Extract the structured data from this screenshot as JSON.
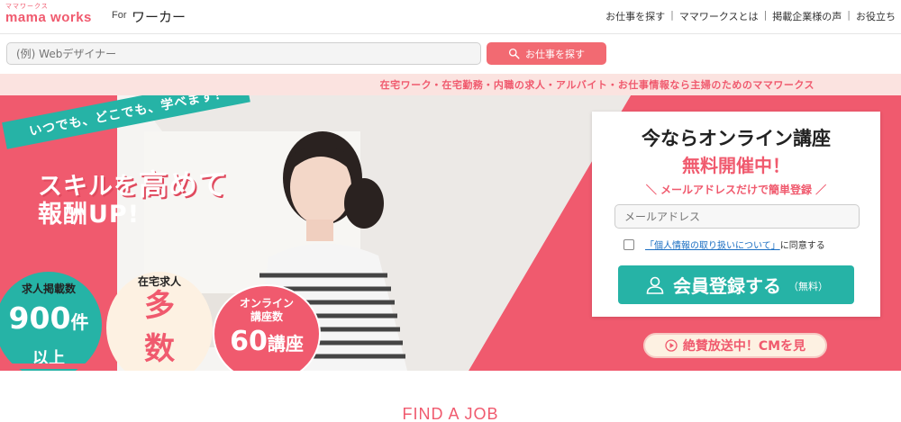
{
  "header": {
    "logo_small": "ママワークス",
    "logo_main": "mama works",
    "logo_for": "For",
    "logo_worker": "ワーカー",
    "nav": [
      "お仕事を探す",
      "ママワークスとは",
      "掲載企業様の声",
      "お役立ち"
    ]
  },
  "search": {
    "placeholder": "(例) Webデザイナー",
    "button_label": "お仕事を探す"
  },
  "tagline": "在宅ワーク・在宅勤務・内職の求人・アルバイト・お仕事情報なら主婦のためのママワークス",
  "hero": {
    "ribbon": "いつでも、どこでも、学べます！",
    "headline1_a": "スキル",
    "headline1_b": "を",
    "headline1_c": "高めて",
    "headline2_a": "報酬",
    "headline2_b": "UP!",
    "stats": [
      {
        "label": "求人掲載数",
        "value": "900",
        "unit": "件",
        "sub": "以上"
      },
      {
        "label": "在宅求人",
        "big1": "多",
        "big2": "数"
      },
      {
        "label1": "オンライン",
        "label2": "講座数",
        "value": "60",
        "unit": "講座"
      }
    ]
  },
  "card": {
    "title": "今ならオンライン講座",
    "free": "無料開催中！",
    "note": "＼ メールアドレスだけで簡単登録 ／",
    "email_placeholder": "メールアドレス",
    "privacy_link": "「個人情報の取り扱いについて」",
    "privacy_suffix": "に同意する",
    "register_label": "会員登録する",
    "register_free": "（無料）"
  },
  "cm_button": "絶賛放送中！CMを見",
  "find_job": "FIND A JOB",
  "colors": {
    "brand_pink": "#f05a6e",
    "teal": "#26b3a6",
    "cream": "#fdf1e2"
  }
}
